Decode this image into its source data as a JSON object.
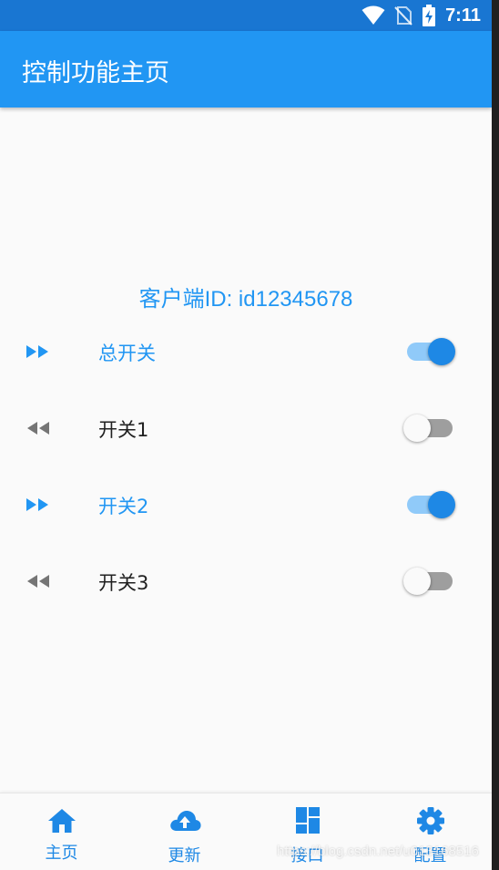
{
  "status_bar": {
    "time": "7:11",
    "icons": [
      "wifi-icon",
      "no-sim-icon",
      "battery-charging-icon"
    ]
  },
  "app_bar": {
    "title": "控制功能主页"
  },
  "client": {
    "id_text": "客户端ID: id12345678"
  },
  "switches": [
    {
      "label": "总开关",
      "state": true,
      "icon": "fast-forward-icon"
    },
    {
      "label": "开关1",
      "state": false,
      "icon": "rewind-icon"
    },
    {
      "label": "开关2",
      "state": true,
      "icon": "fast-forward-icon"
    },
    {
      "label": "开关3",
      "state": false,
      "icon": "rewind-icon"
    }
  ],
  "bottom_nav": [
    {
      "label": "主页",
      "icon": "home-icon"
    },
    {
      "label": "更新",
      "icon": "cloud-upload-icon"
    },
    {
      "label": "接口",
      "icon": "dashboard-icon"
    },
    {
      "label": "配置",
      "icon": "settings-icon"
    }
  ],
  "watermark": "https://blog.csdn.net/u013168516",
  "colors": {
    "status_bar": "#1976d2",
    "app_bar": "#2196f3",
    "accent": "#1e88e5",
    "inactive_icon": "#757575",
    "background": "#fafafa"
  }
}
